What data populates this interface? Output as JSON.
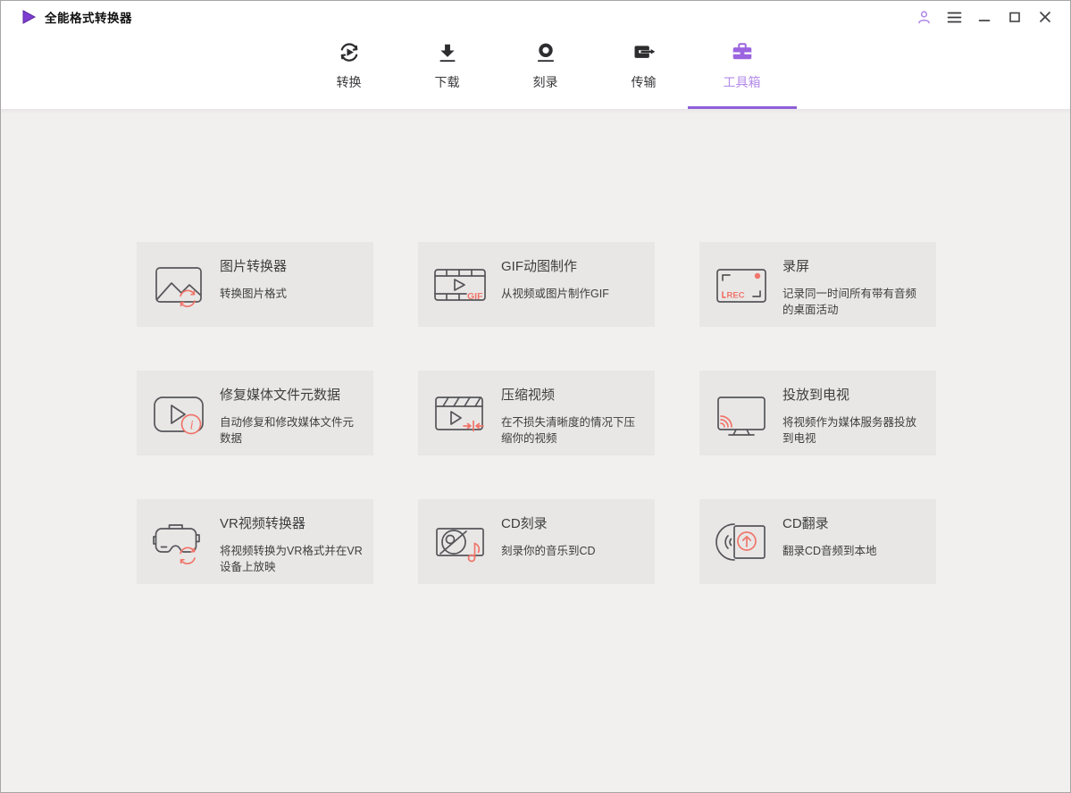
{
  "window": {
    "title": "全能格式转换器",
    "logo_icon": "play-triangle-logo",
    "controls": [
      "account-icon",
      "menu-icon",
      "minimize-icon",
      "maximize-icon",
      "close-icon"
    ]
  },
  "nav": {
    "tabs": [
      {
        "label": "转换",
        "icon": "convert-icon",
        "active": false
      },
      {
        "label": "下载",
        "icon": "download-icon",
        "active": false
      },
      {
        "label": "刻录",
        "icon": "burn-icon",
        "active": false
      },
      {
        "label": "传输",
        "icon": "transfer-icon",
        "active": false
      },
      {
        "label": "工具箱",
        "icon": "toolbox-icon",
        "active": true
      }
    ]
  },
  "toolbox": {
    "cards": [
      {
        "title": "图片转换器",
        "desc": "转换图片格式",
        "icon": "image-converter-icon"
      },
      {
        "title": "GIF动图制作",
        "desc": "从视频或图片制作GIF",
        "icon": "gif-maker-icon",
        "icon_text": "GIF"
      },
      {
        "title": "录屏",
        "desc": "记录同一时间所有带有音频的桌面活动",
        "icon": "screen-recorder-icon",
        "icon_text": "REC"
      },
      {
        "title": "修复媒体文件元数据",
        "desc": "自动修复和修改媒体文件元数据",
        "icon": "fix-metadata-icon",
        "icon_text": "i"
      },
      {
        "title": "压缩视频",
        "desc": "在不损失清晰度的情况下压缩你的视频",
        "icon": "compress-video-icon"
      },
      {
        "title": "投放到电视",
        "desc": "将视频作为媒体服务器投放到电视",
        "icon": "cast-to-tv-icon"
      },
      {
        "title": "VR视频转换器",
        "desc": "将视频转换为VR格式并在VR设备上放映",
        "icon": "vr-converter-icon"
      },
      {
        "title": "CD刻录",
        "desc": "刻录你的音乐到CD",
        "icon": "cd-burn-icon"
      },
      {
        "title": "CD翻录",
        "desc": "翻录CD音频到本地",
        "icon": "cd-rip-icon"
      }
    ]
  },
  "colors": {
    "logo_purple": "#7e3ed2",
    "toolbox_purple": "#9c64e0",
    "toolbox_label_purple": "#b28ae8",
    "underline_purple": "#8f5fd9",
    "coral_accent": "#f0756b",
    "card_bg": "#e8e7e6",
    "content_bg": "#f1f0ef"
  }
}
